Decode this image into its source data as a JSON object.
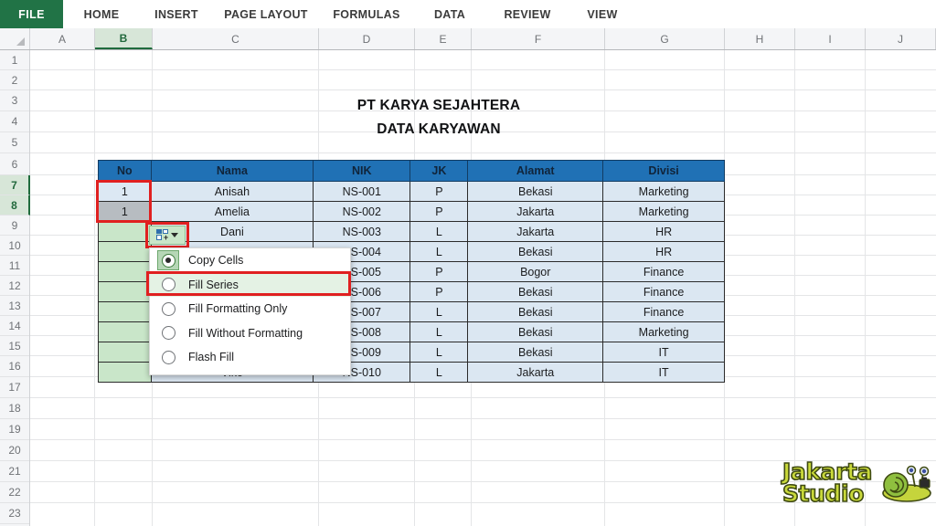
{
  "ribbon": {
    "file": "FILE",
    "tabs": [
      "HOME",
      "INSERT",
      "PAGE LAYOUT",
      "FORMULAS",
      "DATA",
      "REVIEW",
      "VIEW"
    ]
  },
  "grid": {
    "columns": [
      "A",
      "B",
      "C",
      "D",
      "E",
      "F",
      "G",
      "H",
      "I",
      "J"
    ],
    "active_column": "B",
    "rows": [
      "1",
      "2",
      "3",
      "4",
      "5",
      "6",
      "7",
      "8",
      "9",
      "10",
      "11",
      "12",
      "13",
      "14",
      "15",
      "16",
      "17",
      "18",
      "19",
      "20",
      "21",
      "22",
      "23"
    ],
    "active_rows": [
      "7",
      "8"
    ]
  },
  "sheet": {
    "title_line1": "PT KARYA SEJAHTERA",
    "title_line2": "DATA KARYAWAN",
    "headers": [
      "No",
      "Nama",
      "NIK",
      "JK",
      "Alamat",
      "Divisi"
    ],
    "rows": [
      {
        "no": "1",
        "nama": "Anisah",
        "nik": "NS-001",
        "jk": "P",
        "alamat": "Bekasi",
        "divisi": "Marketing"
      },
      {
        "no": "1",
        "nama": "Amelia",
        "nik": "NS-002",
        "jk": "P",
        "alamat": "Jakarta",
        "divisi": "Marketing"
      },
      {
        "no": "",
        "nama": "Dani",
        "nik": "NS-003",
        "jk": "L",
        "alamat": "Jakarta",
        "divisi": "HR"
      },
      {
        "no": "",
        "nama": "",
        "nik": "NS-004",
        "jk": "L",
        "alamat": "Bekasi",
        "divisi": "HR"
      },
      {
        "no": "",
        "nama": "",
        "nik": "NS-005",
        "jk": "P",
        "alamat": "Bogor",
        "divisi": "Finance"
      },
      {
        "no": "",
        "nama": "",
        "nik": "NS-006",
        "jk": "P",
        "alamat": "Bekasi",
        "divisi": "Finance"
      },
      {
        "no": "",
        "nama": "",
        "nik": "NS-007",
        "jk": "L",
        "alamat": "Bekasi",
        "divisi": "Finance"
      },
      {
        "no": "",
        "nama": "",
        "nik": "NS-008",
        "jk": "L",
        "alamat": "Bekasi",
        "divisi": "Marketing"
      },
      {
        "no": "",
        "nama": "",
        "nik": "NS-009",
        "jk": "L",
        "alamat": "Bekasi",
        "divisi": "IT"
      },
      {
        "no": "",
        "nama": "Viko",
        "nik": "NS-010",
        "jk": "L",
        "alamat": "Jakarta",
        "divisi": "IT"
      }
    ]
  },
  "autofill": {
    "icon": "autofill-options-icon",
    "arrow": "chevron-down-icon",
    "menu": [
      {
        "label": "Copy Cells",
        "accel": "C",
        "selected": true
      },
      {
        "label": "Fill Series",
        "accel": "S",
        "selected": false
      },
      {
        "label": "Fill Formatting Only",
        "accel": "F",
        "selected": false
      },
      {
        "label": "Fill Without Formatting",
        "accel": "u",
        "selected": false
      },
      {
        "label": "Flash Fill",
        "accel": "F",
        "selected": false
      }
    ]
  },
  "watermark": {
    "line1": "Jakarta",
    "line2": "Studio",
    "mascot": "snail-mascot-icon"
  },
  "colors": {
    "file_tab_green": "#217346",
    "table_header_blue": "#2071b5",
    "table_cell_blue": "#dbe7f2",
    "annotation_red": "#e02020",
    "fill_green": "#c9e6c9",
    "watermark_yellow": "#c9d93a"
  }
}
